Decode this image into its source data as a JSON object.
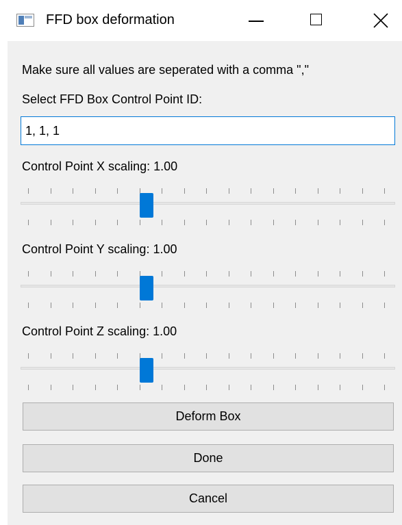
{
  "window": {
    "title": "FFD box deformation"
  },
  "instructions": "Make sure all values are seperated with a comma \",\"",
  "control_point": {
    "label": "Select FFD Box Control Point ID:",
    "value": "1, 1, 1"
  },
  "sliders": [
    {
      "label": "Control Point X scaling: 1.00",
      "position_fraction": 0.33
    },
    {
      "label": "Control Point Y scaling: 1.00",
      "position_fraction": 0.33
    },
    {
      "label": "Control Point Z scaling: 1.00",
      "position_fraction": 0.33
    }
  ],
  "buttons": {
    "deform": "Deform Box",
    "done": "Done",
    "cancel": "Cancel"
  },
  "colors": {
    "accent": "#0078d7",
    "dialog_background": "#f0f0f0",
    "button_face": "#e1e1e1"
  }
}
